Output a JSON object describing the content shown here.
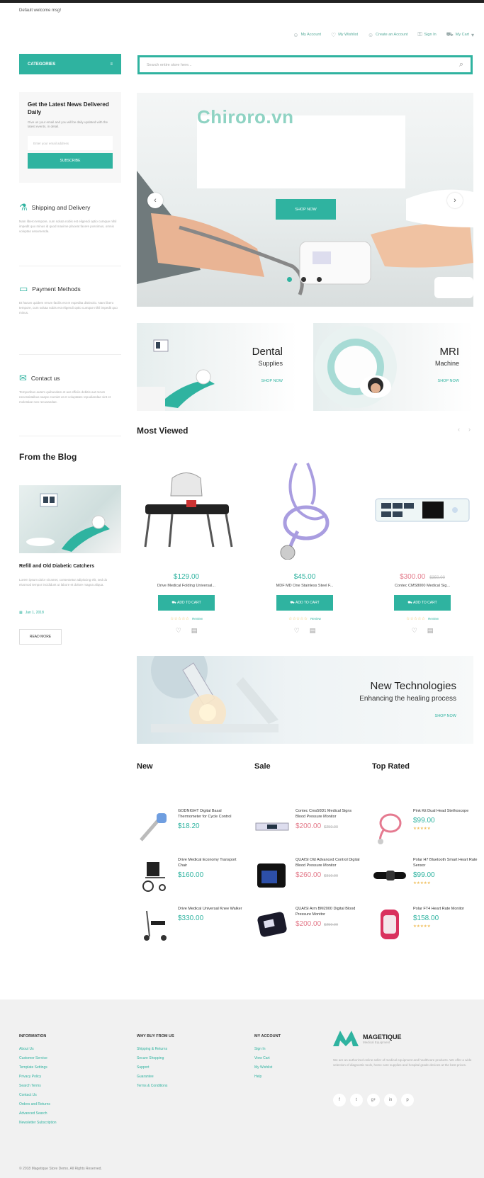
{
  "header": {
    "welcome": "Default welcome msg!",
    "nav": [
      {
        "label": "My Account",
        "icon": "user-icon"
      },
      {
        "label": "My Wishlist",
        "icon": "heart-icon"
      },
      {
        "label": "Create an Account",
        "icon": "user-plus-icon"
      },
      {
        "label": "Sign In",
        "icon": "lock-icon"
      },
      {
        "label": "My Cart",
        "icon": "cart-icon"
      }
    ],
    "categories_label": "Categories",
    "search_placeholder": "Search entire store here..."
  },
  "sidebar": {
    "newsletter": {
      "title": "Get the Latest News Delivered Daily",
      "text": "Give us your email and you will be daily updated with the latest events, in detail.",
      "placeholder": "Enter your email address",
      "button": "Subscribe"
    },
    "features": [
      {
        "title": "Shipping and Delivery",
        "icon": "shipping-icon",
        "text": "Nam libero tempore, cum soluta nobis est eligendi optio cumque nihil impedit quo minus id quod maxime placeat facere possimus, omnis voluptas assumenda."
      },
      {
        "title": "Payment Methods",
        "icon": "wallet-icon",
        "text": "Et harum quidem rerum facilis est et expedita distinctio. Nam libero tempore, cum soluta nobis est eligendi optio cumque nihil impedit quo minus."
      },
      {
        "title": "Contact us",
        "icon": "mail-icon",
        "text": "Temporibus autem quibusdam et aut officiis debitis aut rerum necessitatibus saepe eveniet ut et voluptates repudiandae sint et molestiae non recusandae."
      }
    ],
    "blog": {
      "section_title": "From the Blog",
      "post_title": "Refill and Old Diabetic Catchers",
      "post_text": "Lorem ipsum dolor sit amet, consectetur adipiscing elit, sed do eiusmod tempor incididunt ut labore et dolore magna aliqua.",
      "date": "Jan 1, 2018",
      "read_more": "Read more"
    }
  },
  "hero": {
    "watermark": "Chiroro.vn",
    "button": "Shop now"
  },
  "banners": [
    {
      "title": "Dental",
      "subtitle": "Supplies",
      "link": "Shop now"
    },
    {
      "title": "MRI",
      "subtitle": "Machine",
      "link": "Shop now"
    }
  ],
  "most_viewed": {
    "title": "Most Viewed",
    "products": [
      {
        "price": "$129.00",
        "old": "",
        "name": "Drive Medical Folding Universal...",
        "add": "Add to Cart",
        "reviews": "Review"
      },
      {
        "price": "$45.00",
        "old": "",
        "name": "MDF MD One Stainless Steel F...",
        "add": "Add to Cart",
        "reviews": "Review"
      },
      {
        "price": "$300.00",
        "old": "$350.00",
        "name": "Contec CMS8000 Medical Sig...",
        "add": "Add to Cart",
        "reviews": "Review"
      }
    ]
  },
  "tech_banner": {
    "title": "New Technologies",
    "subtitle": "Enhancing the healing process",
    "link": "Shop now"
  },
  "lists": {
    "new": {
      "title": "New",
      "items": [
        {
          "name": "GODNIGHT Digital Basal Thermometer for Cycle Control",
          "price": "$18.20",
          "old": ""
        },
        {
          "name": "Drive Medical Economy Transport Chair",
          "price": "$160.00",
          "old": ""
        },
        {
          "name": "Drive Medical Universal Knee Walker",
          "price": "$330.00",
          "old": ""
        }
      ]
    },
    "sale": {
      "title": "Sale",
      "items": [
        {
          "name": "Contec Cms50D1 Medical Signs Blood Pressure Monitor",
          "price": "$200.00",
          "old": "$250.00"
        },
        {
          "name": "QUAISI Old Advanced Control Digital Blood Pressure Monitor",
          "price": "$260.00",
          "old": "$310.00"
        },
        {
          "name": "QUAISI Arm BM2000 Digital Blood Pressure Monitor",
          "price": "$200.00",
          "old": "$250.00"
        }
      ]
    },
    "top_rated": {
      "title": "Top Rated",
      "items": [
        {
          "name": "Pink Kit Dual Head Stethoscope",
          "price": "$99.00",
          "old": ""
        },
        {
          "name": "Polar H7 Bluetooth Smart Heart Rate Sensor",
          "price": "$99.00",
          "old": ""
        },
        {
          "name": "Polar FT4 Heart Rate Monitor",
          "price": "$158.00",
          "old": ""
        }
      ]
    }
  },
  "footer": {
    "columns": [
      {
        "title": "Information",
        "links": [
          "About Us",
          "Customer Service",
          "Template Settings",
          "Privacy Policy",
          "Search Terms",
          "Contact Us",
          "Orders and Returns",
          "Advanced Search",
          "Newsletter Subscription"
        ]
      },
      {
        "title": "Why buy from us",
        "links": [
          "Shipping & Returns",
          "Secure Shopping",
          "Support",
          "Guarantee",
          "Terms & Conditions"
        ]
      },
      {
        "title": "My account",
        "links": [
          "Sign In",
          "View Cart",
          "My Wishlist",
          "Help"
        ]
      }
    ],
    "brand": "MAGETIQUE",
    "brand_sub": "Medical Equipment",
    "desc": "We are an authorized online seller of medical equipment and healthcare products. We offer a wide selection of diagnostic tools, home care supplies and hospital grade devices at the best prices.",
    "social": [
      "f",
      "t",
      "g+",
      "in",
      "p"
    ],
    "copyright": "© 2018 Magetique Store Demo. All Rights Reserved."
  },
  "colors": {
    "accent": "#2fb3a0",
    "sale": "#e37a8a"
  }
}
